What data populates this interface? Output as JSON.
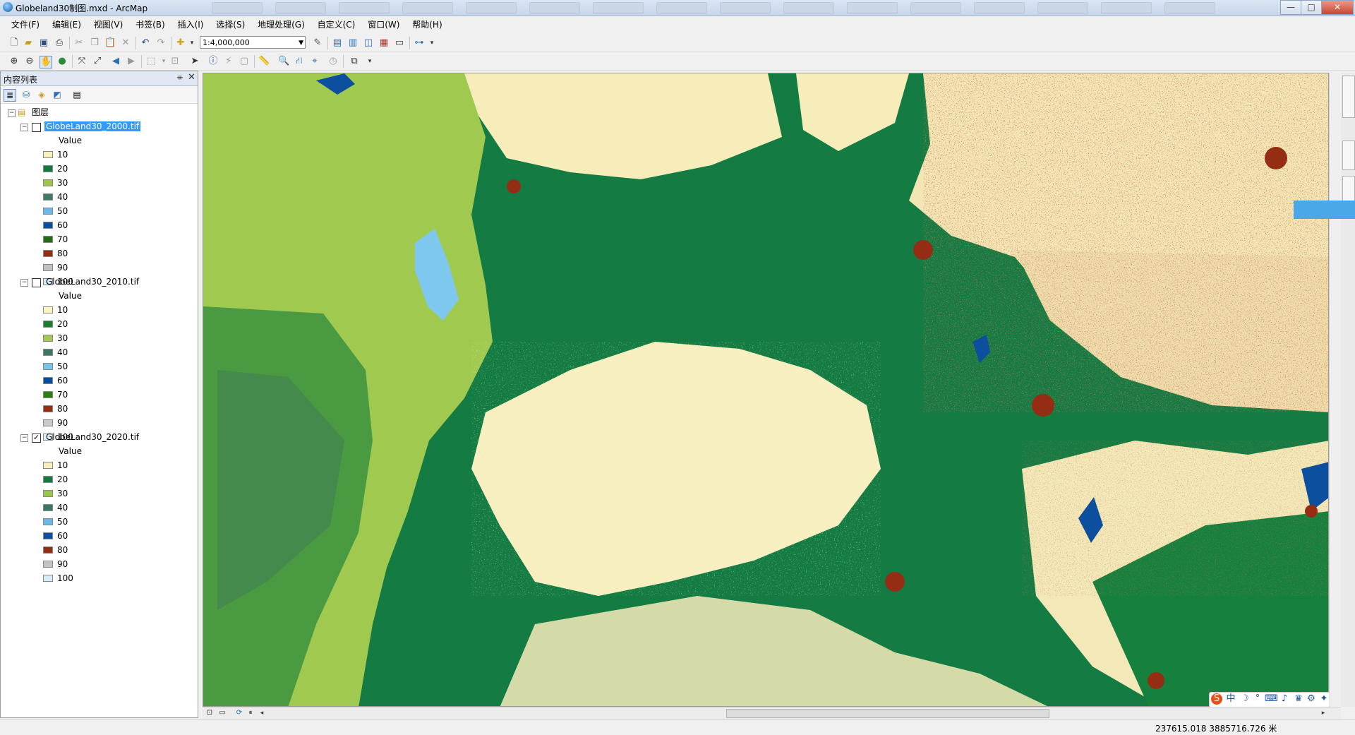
{
  "window": {
    "title": "Globeland30制图.mxd - ArcMap",
    "buttons": {
      "minimize": "—",
      "maximize": "□",
      "close": "✕"
    }
  },
  "menu": [
    "文件(F)",
    "编辑(E)",
    "视图(V)",
    "书签(B)",
    "插入(I)",
    "选择(S)",
    "地理处理(G)",
    "自定义(C)",
    "窗口(W)",
    "帮助(H)"
  ],
  "toolbar": {
    "scale": "1:4,000,000"
  },
  "toc": {
    "title": "内容列表",
    "pin": "ᚑ",
    "close": "✕",
    "root_label": "图层",
    "value_heading": "Value",
    "layers": [
      {
        "name": "GlobeLand30_2000.tif",
        "checked": false,
        "legend": [
          {
            "value": "10",
            "color": "#f7efbc"
          },
          {
            "value": "20",
            "color": "#107a3f"
          },
          {
            "value": "30",
            "color": "#9cc84a"
          },
          {
            "value": "40",
            "color": "#3e7a66"
          },
          {
            "value": "50",
            "color": "#6bbbe8"
          },
          {
            "value": "60",
            "color": "#0d4f9f"
          },
          {
            "value": "70",
            "color": "#226a16"
          },
          {
            "value": "80",
            "color": "#942e13"
          },
          {
            "value": "90",
            "color": "#c2c2c2"
          },
          {
            "value": "100",
            "color": "#d4ecf7"
          }
        ]
      },
      {
        "name": "GlobeLand30_2010.tif",
        "checked": false,
        "legend": [
          {
            "value": "10",
            "color": "#fbf4c0"
          },
          {
            "value": "20",
            "color": "#1a7d33"
          },
          {
            "value": "30",
            "color": "#a4ca55"
          },
          {
            "value": "40",
            "color": "#3a7768"
          },
          {
            "value": "50",
            "color": "#79c3ec"
          },
          {
            "value": "60",
            "color": "#0a4c9b"
          },
          {
            "value": "70",
            "color": "#2b7e12"
          },
          {
            "value": "80",
            "color": "#962d15"
          },
          {
            "value": "90",
            "color": "#c8c8c8"
          },
          {
            "value": "100",
            "color": "#dcf2fb"
          }
        ]
      },
      {
        "name": "GlobeLand30_2020.tif",
        "checked": true,
        "legend": [
          {
            "value": "10",
            "color": "#f8edbb"
          },
          {
            "value": "20",
            "color": "#137a42"
          },
          {
            "value": "30",
            "color": "#98c74d"
          },
          {
            "value": "40",
            "color": "#3c7664"
          },
          {
            "value": "50",
            "color": "#6ab9e6"
          },
          {
            "value": "60",
            "color": "#0c509f"
          },
          {
            "value": "80",
            "color": "#942d14"
          },
          {
            "value": "90",
            "color": "#c4c4c4"
          },
          {
            "value": "100",
            "color": "#d2eef9"
          }
        ]
      }
    ]
  },
  "status": {
    "coordinates": "237615.018  3885716.726 米"
  }
}
